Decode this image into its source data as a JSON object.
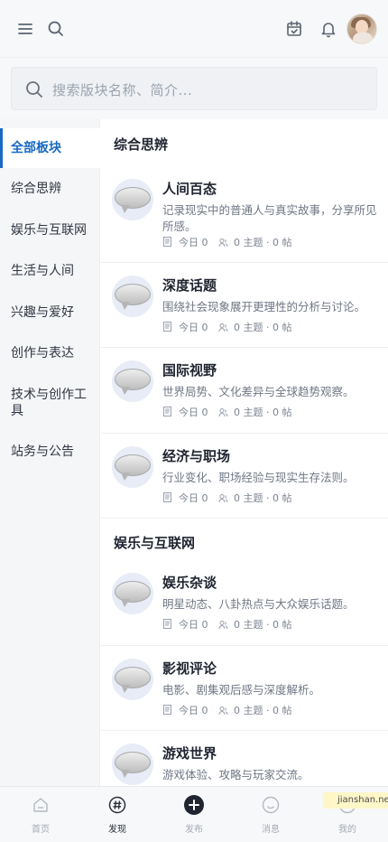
{
  "search": {
    "placeholder": "搜索版块名称、简介..."
  },
  "sidebar": {
    "items": [
      {
        "label": "全部板块",
        "active": true
      },
      {
        "label": "综合思辨"
      },
      {
        "label": "娱乐与互联网"
      },
      {
        "label": "生活与人间"
      },
      {
        "label": "兴趣与爱好"
      },
      {
        "label": "创作与表达"
      },
      {
        "label": "技术与创作工具"
      },
      {
        "label": "站务与公告"
      }
    ]
  },
  "sections": [
    {
      "title": "综合思辨",
      "boards": [
        {
          "name": "人间百态",
          "desc": "记录现实中的普通人与真实故事，分享所见所感。",
          "today": "今日 0",
          "stats": "0 主题 · 0 帖"
        },
        {
          "name": "深度话题",
          "desc": "围绕社会现象展开更理性的分析与讨论。",
          "today": "今日 0",
          "stats": "0 主题 · 0 帖"
        },
        {
          "name": "国际视野",
          "desc": "世界局势、文化差异与全球趋势观察。",
          "today": "今日 0",
          "stats": "0 主题 · 0 帖"
        },
        {
          "name": "经济与职场",
          "desc": "行业变化、职场经验与现实生存法则。",
          "today": "今日 0",
          "stats": "0 主题 · 0 帖"
        }
      ]
    },
    {
      "title": "娱乐与互联网",
      "boards": [
        {
          "name": "娱乐杂谈",
          "desc": "明星动态、八卦热点与大众娱乐话题。",
          "today": "今日 0",
          "stats": "0 主题 · 0 帖"
        },
        {
          "name": "影视评论",
          "desc": "电影、剧集观后感与深度解析。",
          "today": "今日 0",
          "stats": "0 主题 · 0 帖"
        },
        {
          "name": "游戏世界",
          "desc": "游戏体验、攻略与玩家交流。"
        }
      ]
    }
  ],
  "bottom_nav": [
    {
      "label": "首页",
      "icon": "home-icon"
    },
    {
      "label": "发现",
      "icon": "hashtag-icon",
      "active": true
    },
    {
      "label": "发布",
      "icon": "plus-circle-icon"
    },
    {
      "label": "消息",
      "icon": "chat-icon"
    },
    {
      "label": "我的",
      "icon": "profile-icon"
    }
  ],
  "watermark": "jianshan.ne",
  "colors": {
    "accent": "#1769c4",
    "text": "#1f2430",
    "muted": "#7c8492"
  }
}
